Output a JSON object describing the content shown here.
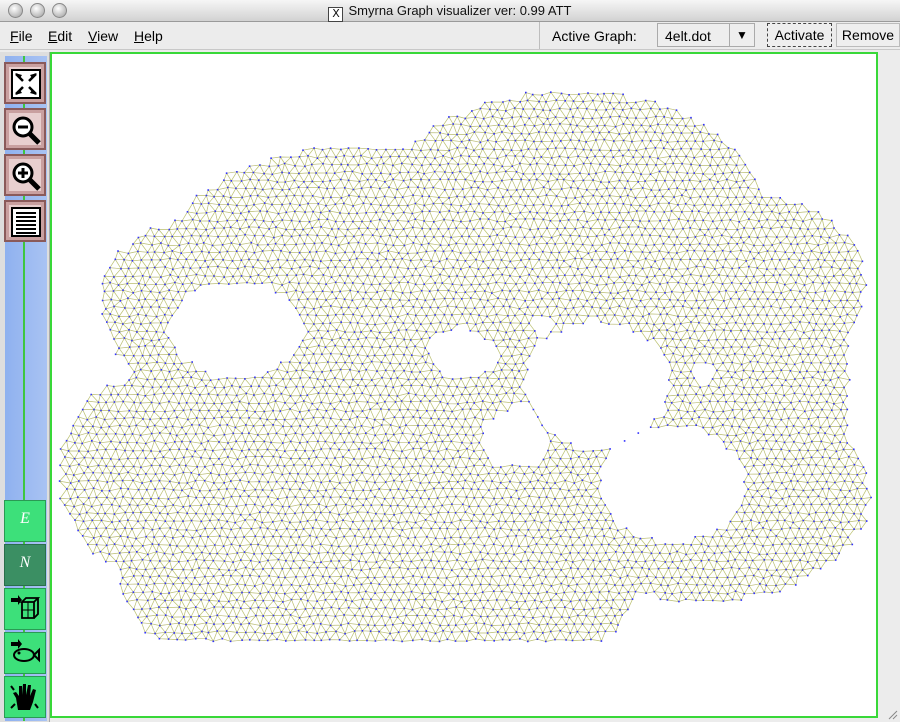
{
  "window": {
    "title": "Smyrna Graph visualizer ver: 0.99  ATT",
    "title_icon": "x11-icon",
    "title_icon_glyph": "X"
  },
  "menu": {
    "items": [
      "File",
      "Edit",
      "View",
      "Help"
    ]
  },
  "toolbar": {
    "active_graph_label": "Active Graph:",
    "active_graph_value": "4elt.dot",
    "activate_label": "Activate",
    "remove_label": "Remove"
  },
  "side_tools": [
    {
      "name": "fit-to-window-icon",
      "label": ""
    },
    {
      "name": "zoom-out-icon",
      "label": ""
    },
    {
      "name": "zoom-in-icon",
      "label": ""
    },
    {
      "name": "attributes-list-icon",
      "label": ""
    },
    {
      "name": "edge-mode-button",
      "label": "E"
    },
    {
      "name": "node-mode-button",
      "label": "N"
    },
    {
      "name": "3d-view-icon",
      "label": ""
    },
    {
      "name": "fisheye-icon",
      "label": ""
    },
    {
      "name": "pan-hand-icon",
      "label": ""
    }
  ],
  "colors": {
    "canvas_border": "#38d838",
    "node": "#3030ff",
    "edge": "#b8cc50",
    "edge_secondary": "#c8a0d8"
  }
}
